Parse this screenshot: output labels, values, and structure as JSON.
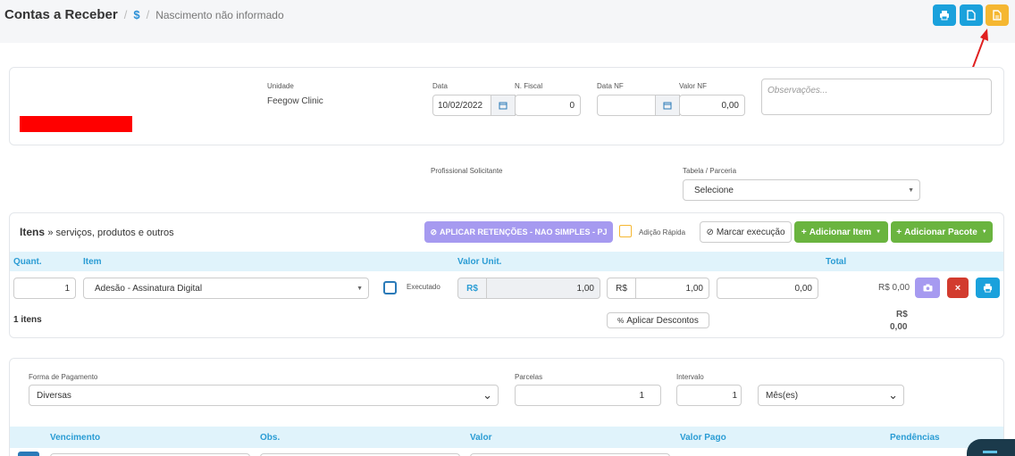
{
  "header": {
    "title": "Contas a Receber",
    "sep": "/",
    "dollar": "$",
    "crumb": "Nascimento não informado"
  },
  "colors": {
    "primary": "#1aa1dc",
    "warning": "#f5b731",
    "success": "#6ab43f",
    "danger": "#d23b2e",
    "purple": "#a69af0"
  },
  "account": {
    "unidade_label": "Unidade",
    "unidade_value": "Feegow Clinic",
    "data_label": "Data",
    "data_value": "10/02/2022",
    "nfiscal_label": "N. Fiscal",
    "nfiscal_value": "0",
    "datanf_label": "Data NF",
    "datanf_value": "",
    "valornf_label": "Valor NF",
    "valornf_value": "0,00",
    "obs_placeholder": "Observações..."
  },
  "request": {
    "prof_label": "Profissional Solicitante",
    "tabela_label": "Tabela / Parceria",
    "tabela_value": "Selecione"
  },
  "items": {
    "title": "Itens",
    "subtitle": "» serviços, produtos e outros",
    "apply_retention": "APLICAR RETENÇÕES - NAO SIMPLES - PJ",
    "quick_add": "Adição Rápida",
    "mark_exec": "Marcar execução",
    "add_item": "Adicionar Item",
    "add_package": "Adicionar Pacote",
    "cols": {
      "qty": "Quant.",
      "item": "Item",
      "unit": "Valor Unit.",
      "total": "Total"
    },
    "row": {
      "qty": "1",
      "item": "Adesão - Assinatura Digital",
      "executed": "Executado",
      "currency": "R$",
      "unit_value": "1,00",
      "value2": "1,00",
      "value3": "0,00",
      "total": "R$ 0,00"
    },
    "count": "1 itens",
    "apply_discounts": "Aplicar Descontos",
    "total_currency": "R$",
    "total_value": "0,00"
  },
  "payment": {
    "forma_label": "Forma de Pagamento",
    "forma_value": "Diversas",
    "parcelas_label": "Parcelas",
    "parcelas_value": "1",
    "intervalo_label": "Intervalo",
    "intervalo_value": "1",
    "periodo_value": "Mês(es)",
    "cols": {
      "venc": "Vencimento",
      "obs": "Obs.",
      "valor": "Valor",
      "pago": "Valor Pago",
      "pend": "Pendências"
    }
  }
}
